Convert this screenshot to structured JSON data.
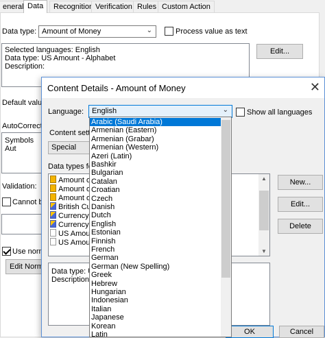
{
  "tabs": [
    "eneral",
    "Data",
    "Recognition",
    "Verification",
    "Rules",
    "Custom Action"
  ],
  "panel": {
    "data_type_label": "Data type:",
    "data_type_value": "Amount of Money",
    "process_value_label": "Process value as text",
    "info_lines": [
      "Selected languages: English",
      "Data type: US Amount - Alphabet",
      "Description:"
    ],
    "edit_button": "Edit...",
    "default_value_label": "Default value",
    "autocorrect_label": "AutoCorrect o",
    "autocorrect_text": "Symbols Aut",
    "validation_label": "Validation:",
    "cannot_be_label": "Cannot be",
    "use_norm_label": "Use norm",
    "edit_norm_button": "Edit Norma"
  },
  "modal": {
    "title": "Content Details - Amount of Money",
    "close_glyph": "✕",
    "language_label": "Language:",
    "language_value": "English",
    "show_all_label": "Show all languages",
    "content_settings_label": "Content setti",
    "content_settings_value": "Special",
    "data_types_label": "Data types for",
    "data_types": [
      {
        "text": "Amount of",
        "icon": "gold"
      },
      {
        "text": "Amount of",
        "icon": "gold"
      },
      {
        "text": "Amount of",
        "icon": "gold"
      },
      {
        "text": "British Cur",
        "icon": "blue"
      },
      {
        "text": "Currency",
        "icon": "blue"
      },
      {
        "text": "Currency",
        "icon": "blue"
      },
      {
        "text": "US Amoun",
        "icon": "plain"
      },
      {
        "text": "US Amoun",
        "icon": "plain"
      }
    ],
    "new_button": "New...",
    "edit_button": "Edit...",
    "delete_button": "Delete",
    "detail_lines": [
      "Data type: U",
      "Description:"
    ],
    "ok_button": "OK",
    "cancel_button": "Cancel"
  },
  "language_options": [
    "Arabic (Saudi Arabia)",
    "Armenian (Eastern)",
    "Armenian (Grabar)",
    "Armenian (Western)",
    "Azeri (Latin)",
    "Bashkir",
    "Bulgarian",
    "Catalan",
    "Croatian",
    "Czech",
    "Danish",
    "Dutch",
    "English",
    "Estonian",
    "Finnish",
    "French",
    "German",
    "German (New Spelling)",
    "Greek",
    "Hebrew",
    "Hungarian",
    "Indonesian",
    "Italian",
    "Japanese",
    "Korean",
    "Latin"
  ],
  "selected_language_index": 0
}
